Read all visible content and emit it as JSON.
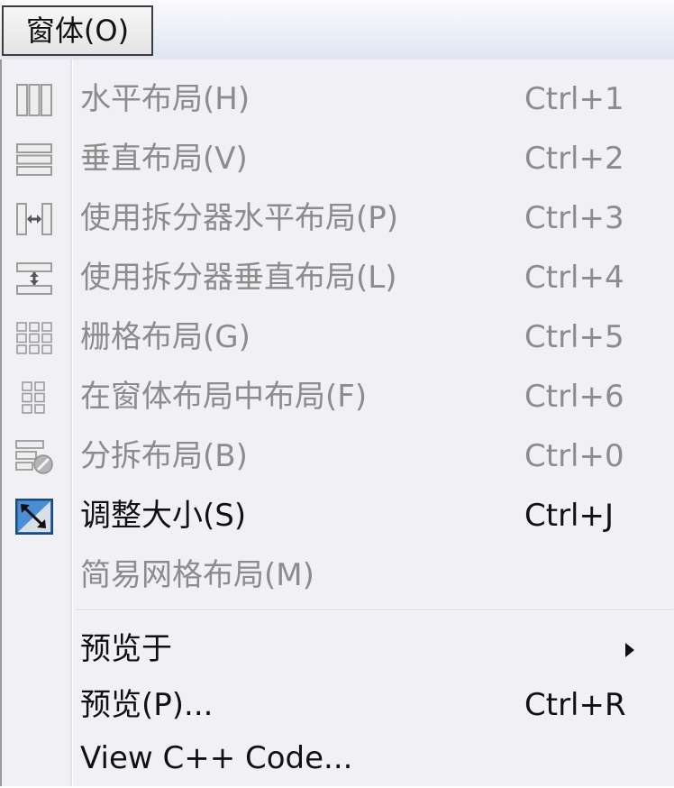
{
  "menubar": {
    "title": "窗体(O)"
  },
  "menu": {
    "items": [
      {
        "label": "水平布局(H)",
        "shortcut": "Ctrl+1",
        "enabled": false
      },
      {
        "label": "垂直布局(V)",
        "shortcut": "Ctrl+2",
        "enabled": false
      },
      {
        "label": "使用拆分器水平布局(P)",
        "shortcut": "Ctrl+3",
        "enabled": false
      },
      {
        "label": "使用拆分器垂直布局(L)",
        "shortcut": "Ctrl+4",
        "enabled": false
      },
      {
        "label": "栅格布局(G)",
        "shortcut": "Ctrl+5",
        "enabled": false
      },
      {
        "label": "在窗体布局中布局(F)",
        "shortcut": "Ctrl+6",
        "enabled": false
      },
      {
        "label": "分拆布局(B)",
        "shortcut": "Ctrl+0",
        "enabled": false
      },
      {
        "label": "调整大小(S)",
        "shortcut": "Ctrl+J",
        "enabled": true
      },
      {
        "label": "简易网格布局(M)",
        "shortcut": "",
        "enabled": false
      },
      {
        "label": "预览于",
        "shortcut": "",
        "enabled": true,
        "submenu": true
      },
      {
        "label": "预览(P)...",
        "shortcut": "Ctrl+R",
        "enabled": true
      },
      {
        "label": "View C++ Code...",
        "shortcut": "",
        "enabled": true
      }
    ]
  },
  "icons": {
    "horizontal_layout": "horizontal-layout-icon",
    "vertical_layout": "vertical-layout-icon",
    "splitter_horizontal": "splitter-horizontal-icon",
    "splitter_vertical": "splitter-vertical-icon",
    "grid_layout": "grid-layout-icon",
    "form_layout": "form-layout-icon",
    "break_layout": "break-layout-icon",
    "adjust_size": "adjust-size-icon"
  },
  "colors": {
    "menu_background": "#f1f0f5",
    "disabled_text": "#8c8c8c",
    "enabled_text": "#111111",
    "adjust_icon_blue": "#2a6fb8"
  }
}
